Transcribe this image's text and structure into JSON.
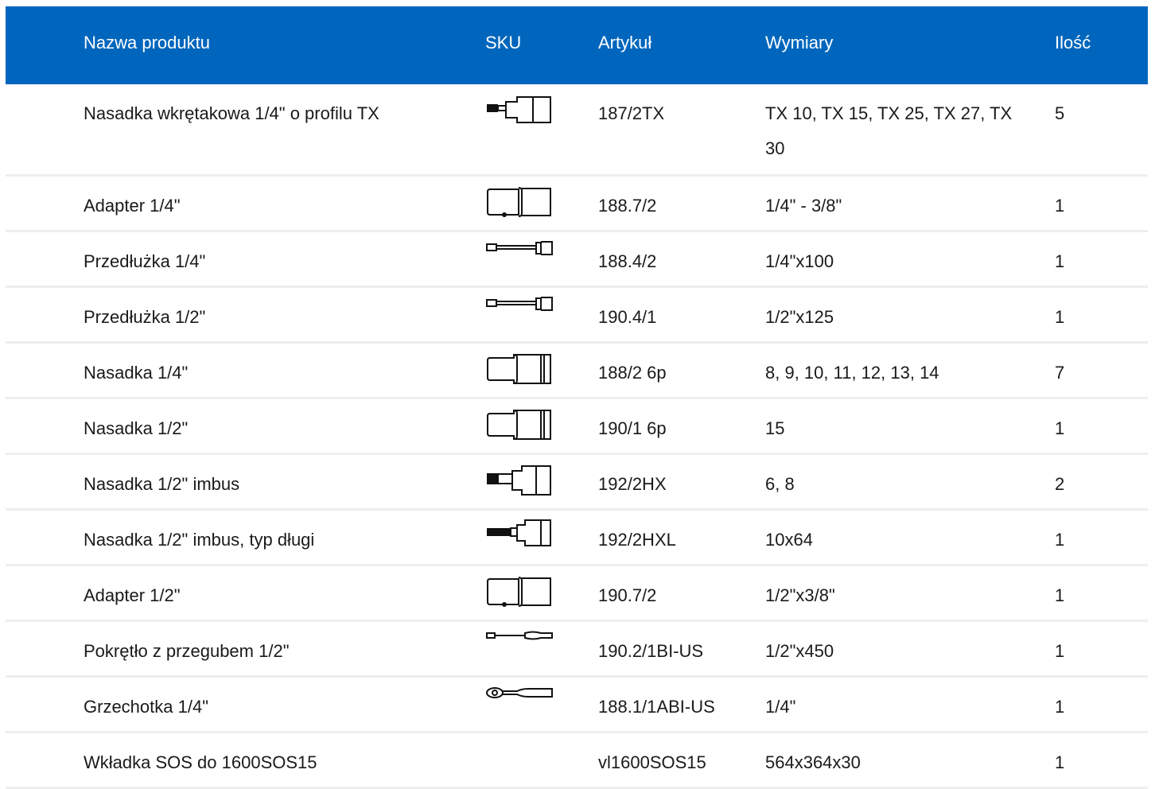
{
  "table": {
    "headers": {
      "name": "Nazwa produktu",
      "sku": "SKU",
      "article": "Artykuł",
      "dimensions": "Wymiary",
      "quantity": "Ilość"
    },
    "header_color": "#0066bd",
    "rows": [
      {
        "name": "Nasadka wkrętakowa 1/4\" o profilu TX",
        "icon": "tx-bit-socket-icon",
        "article": "187/2TX",
        "dimensions": "TX 10, TX 15, TX 25, TX 27, TX 30",
        "quantity": "5"
      },
      {
        "name": "Adapter 1/4\"",
        "icon": "adapter-icon",
        "article": "188.7/2",
        "dimensions": "1/4\" - 3/8\"",
        "quantity": "1"
      },
      {
        "name": "Przedłużka 1/4\"",
        "icon": "extension-bar-icon",
        "article": "188.4/2",
        "dimensions": "1/4\"x100",
        "quantity": "1"
      },
      {
        "name": "Przedłużka 1/2\"",
        "icon": "extension-bar-icon",
        "article": "190.4/1",
        "dimensions": "1/2\"x125",
        "quantity": "1"
      },
      {
        "name": "Nasadka 1/4\"",
        "icon": "socket-icon",
        "article": "188/2 6p",
        "dimensions": "8, 9, 10, 11, 12, 13, 14",
        "quantity": "7"
      },
      {
        "name": "Nasadka 1/2\"",
        "icon": "socket-icon",
        "article": "190/1 6p",
        "dimensions": "15",
        "quantity": "1"
      },
      {
        "name": "Nasadka 1/2\" imbus",
        "icon": "hex-bit-socket-icon",
        "article": "192/2HX",
        "dimensions": "6, 8",
        "quantity": "2"
      },
      {
        "name": "Nasadka 1/2\" imbus, typ długi",
        "icon": "long-hex-bit-socket-icon",
        "article": "192/2HXL",
        "dimensions": "10x64",
        "quantity": "1"
      },
      {
        "name": "Adapter 1/2\"",
        "icon": "adapter-icon",
        "article": "190.7/2",
        "dimensions": "1/2\"x3/8\"",
        "quantity": "1"
      },
      {
        "name": "Pokrętło z przegubem 1/2\"",
        "icon": "breaker-bar-icon",
        "article": "190.2/1BI-US",
        "dimensions": "1/2\"x450",
        "quantity": "1"
      },
      {
        "name": "Grzechotka 1/4\"",
        "icon": "ratchet-icon",
        "article": "188.1/1ABI-US",
        "dimensions": "1/4\"",
        "quantity": "1"
      },
      {
        "name": "Wkładka SOS do 1600SOS15",
        "icon": "",
        "article": "vl1600SOS15",
        "dimensions": "564x364x30",
        "quantity": "1"
      }
    ]
  }
}
